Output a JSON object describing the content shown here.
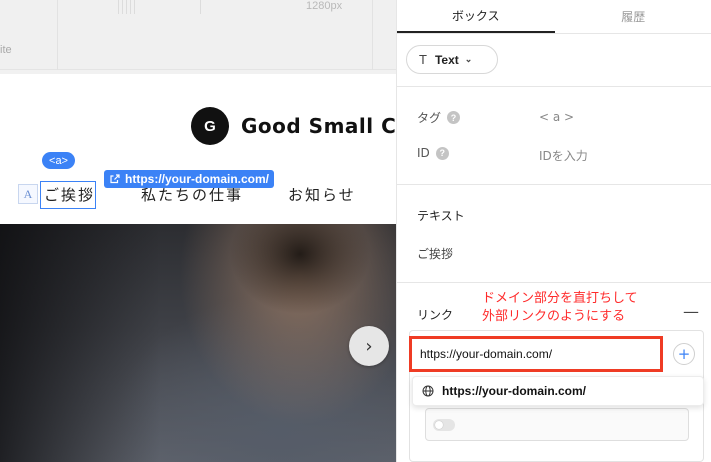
{
  "canvas": {
    "ruler_width_label": "1280px",
    "ruler_left_text": "ite",
    "site": {
      "logo_letter": "G",
      "brand_name": "Good Small Co",
      "tag_badge": "<a>",
      "url_chip": "https://your-domain.com/",
      "text_icon": "A",
      "nav_items": [
        "ご挨拶",
        "私たちの仕事",
        "お知らせ"
      ]
    },
    "slider_next": "›"
  },
  "panel": {
    "tabs": [
      {
        "label": "ボックス",
        "active": true
      },
      {
        "label": "履歴",
        "active": false
      }
    ],
    "element_type": {
      "icon": "T",
      "label": "Text",
      "chevron": "⌄"
    },
    "tag": {
      "label": "タグ",
      "help": "?",
      "value": "< a >"
    },
    "id": {
      "label": "ID",
      "help": "?",
      "placeholder": "IDを入力"
    },
    "text_section": {
      "title": "テキスト",
      "value": "ご挨拶"
    },
    "link_section": {
      "title": "リンク",
      "collapse_icon": "—",
      "annotation": [
        "ドメイン部分を直打ちして",
        "外部リンクのようにする"
      ],
      "input_value": "https://your-domain.com/",
      "add_button": "+",
      "suggestion": "https://your-domain.com/",
      "toggle_on": false
    }
  },
  "colors": {
    "accent_blue": "#3b82f6",
    "annotation_red": "#ff2b2b",
    "highlight_border": "#ef3b24"
  }
}
